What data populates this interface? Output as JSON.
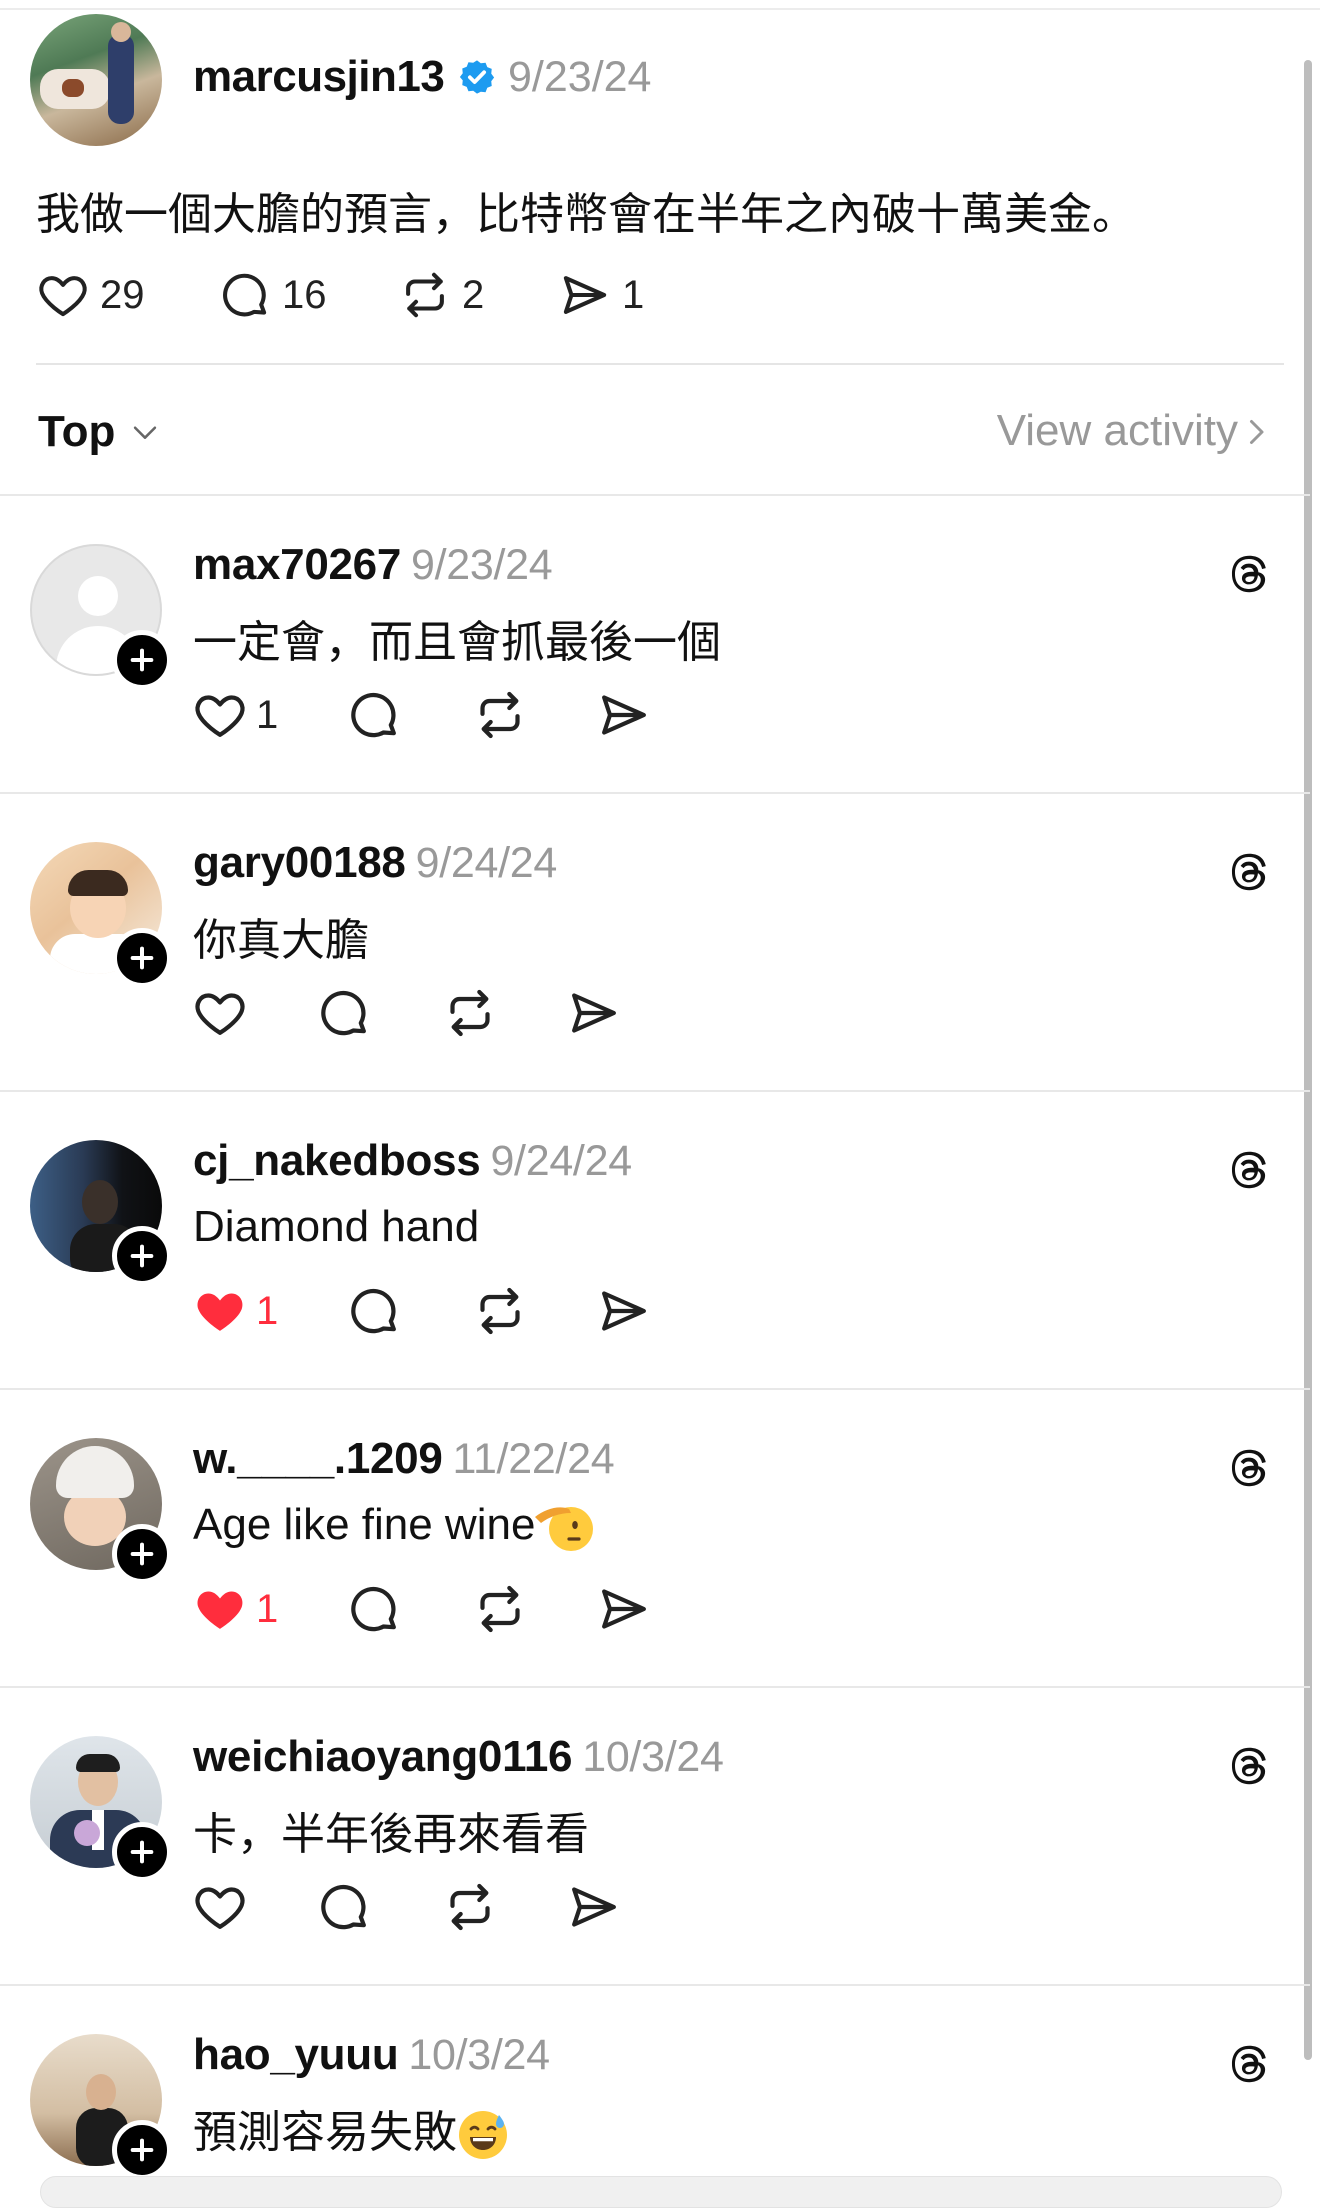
{
  "colors": {
    "verified": "#1d9bf0",
    "muted": "#999999",
    "like_active": "#ff2d3d"
  },
  "post": {
    "username": "marcusjin13",
    "date": "9/23/24",
    "text": "我做一個大膽的預言，比特幣會在半年之內破十萬美金。",
    "likes": "29",
    "comments": "16",
    "reposts": "2",
    "shares": "1"
  },
  "sort": {
    "label": "Top",
    "view_activity": "View activity"
  },
  "replies": [
    {
      "username": "max70267",
      "date": "9/23/24",
      "text": "一定會，而且會抓最後一個",
      "likes": "1",
      "liked": false
    },
    {
      "username": "gary00188",
      "date": "9/24/24",
      "text": "你真大膽",
      "likes": "",
      "liked": false
    },
    {
      "username": "cj_nakedboss",
      "date": "9/24/24",
      "text": "Diamond hand",
      "likes": "1",
      "liked": true
    },
    {
      "username": "w.____.1209",
      "date": "11/22/24",
      "text": "Age like fine wine",
      "likes": "1",
      "liked": true,
      "emoji": "saluting-face"
    },
    {
      "username": "weichiaoyang0116",
      "date": "10/3/24",
      "text": "卡，半年後再來看看",
      "likes": "",
      "liked": false
    },
    {
      "username": "hao_yuuu",
      "date": "10/3/24",
      "text": "預測容易失敗",
      "likes": "",
      "liked": false,
      "emoji": "grinning-sweat-face"
    }
  ]
}
